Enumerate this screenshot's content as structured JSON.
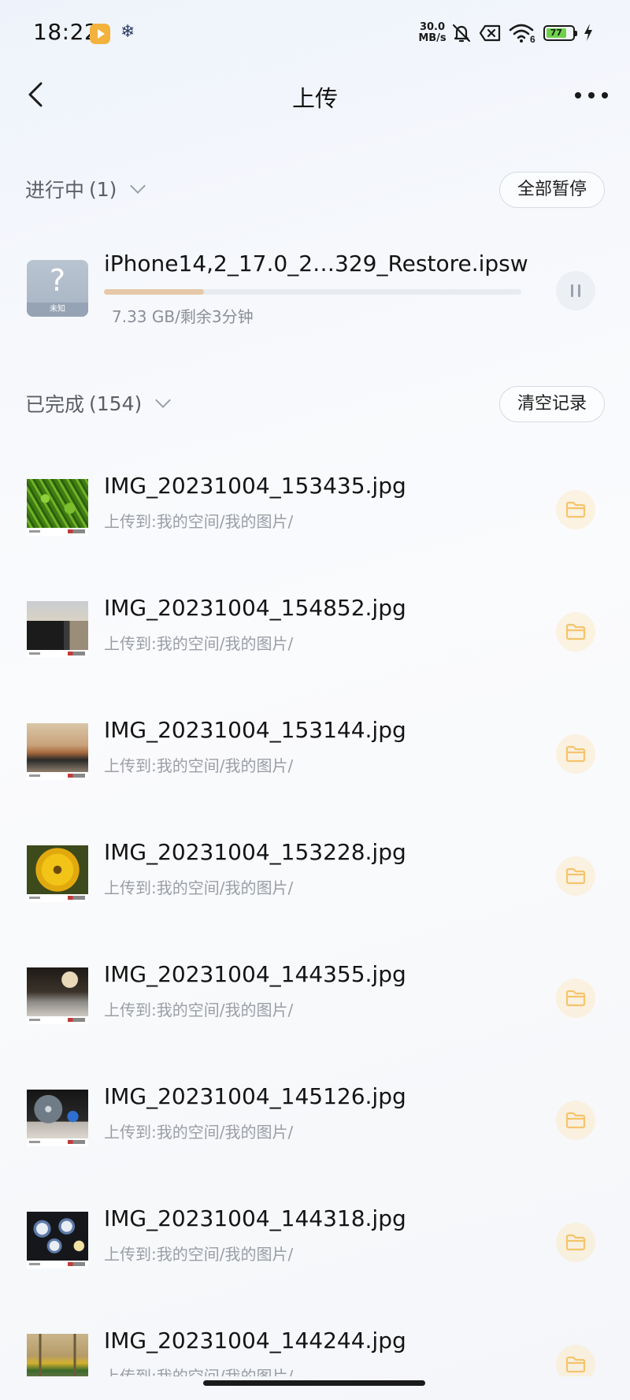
{
  "status_bar": {
    "time": "18:22",
    "net_speed_value": "30.0",
    "net_speed_unit": "MB/s",
    "battery_level": "77"
  },
  "nav": {
    "title": "上传"
  },
  "in_progress": {
    "label": "进行中",
    "count": "(1)",
    "action": "全部暂停",
    "item": {
      "icon_label": "未知",
      "name": "iPhone14,2_17.0_2…329_Restore.ipsw",
      "progress": 0.24,
      "meta": "7.33 GB/剩余3分钟"
    }
  },
  "completed": {
    "label": "已完成",
    "count": "(154)",
    "action": "清空记录",
    "items": [
      {
        "name": "IMG_20231004_153435.jpg",
        "dest": "上传到:我的空间/我的图片/",
        "thumb": "green-plants"
      },
      {
        "name": "IMG_20231004_154852.jpg",
        "dest": "上传到:我的空间/我的图片/",
        "thumb": "steam-locomotive"
      },
      {
        "name": "IMG_20231004_153144.jpg",
        "dest": "上传到:我的空间/我的图片/",
        "thumb": "museum-wall"
      },
      {
        "name": "IMG_20231004_153228.jpg",
        "dest": "上传到:我的空间/我的图片/",
        "thumb": "yellow-flower"
      },
      {
        "name": "IMG_20231004_144355.jpg",
        "dest": "上传到:我的空间/我的图片/",
        "thumb": "vintage-machine"
      },
      {
        "name": "IMG_20231004_145126.jpg",
        "dest": "上传到:我的空间/我的图片/",
        "thumb": "electric-fan"
      },
      {
        "name": "IMG_20231004_144318.jpg",
        "dest": "上传到:我的空间/我的图片/",
        "thumb": "porcelain-plates"
      },
      {
        "name": "IMG_20231004_144244.jpg",
        "dest": "上传到:我的空间/我的图片/",
        "thumb": "building-facade"
      }
    ]
  },
  "colors": {
    "progress_fill": "#e7c9a8",
    "folder_icon": "#f5c46b",
    "secondary_text": "#9a9ea5"
  }
}
